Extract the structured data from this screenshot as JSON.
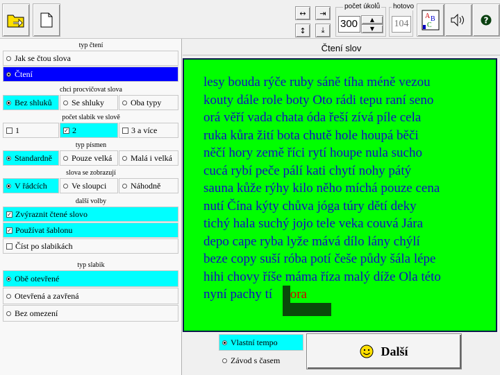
{
  "toolbar": {
    "pocet_ukolu_label": "počet úkolů",
    "pocet_ukolu_value": "300",
    "hotovo_label": "hotovo",
    "hotovo_value": "104"
  },
  "left": {
    "typ_cteni": {
      "title": "typ čtení",
      "opts": [
        "Jak se čtou slova",
        "Čtení"
      ]
    },
    "procvicovat": {
      "title": "chci procvičovat slova",
      "opts": [
        "Bez shluků",
        "Se shluky",
        "Oba typy"
      ]
    },
    "slabiky": {
      "title": "počet slabik ve slově",
      "opts": [
        "1",
        "2",
        "3 a více"
      ]
    },
    "pismen": {
      "title": "typ písmen",
      "opts": [
        "Standardně",
        "Pouze velká",
        "Malá i velká"
      ]
    },
    "zobrazuji": {
      "title": "slova se zobrazují",
      "opts": [
        "V řádcích",
        "Ve sloupci",
        "Náhodně"
      ]
    },
    "dalsi": {
      "title": "další volby",
      "opts": [
        "Zvýraznit čtené slovo",
        "Používat šablonu",
        "Číst po slabikách"
      ]
    },
    "typ_slabik": {
      "title": "typ slabik",
      "opts": [
        "Obě otevřené",
        "Otevřená a zavřená",
        "Bez omezení"
      ]
    }
  },
  "main": {
    "title": "Čtení slov",
    "lines": [
      "lesy bouda rýče ruby sáně tíha méně vezou",
      "kouty dále role boty Oto rádi tepu raní seno",
      "orá věří vada chata óda řeší zívá píle cela",
      "ruka kůra žití bota chutě hole houpá běči",
      "něčí hory země říci rytí houpe nula sucho",
      "cucá rybí peče pálí kati chytí nohy pátý",
      "sauna kůže rýhy kilo něho míchá pouze cena",
      "nutí Čína kýty chůva jóga túry dětí deky",
      "tichý hala suchý jojo tele veka couvá Jára",
      "depo cape ryba lyže mává dílo lány chýlí",
      "beze copy suší róba potí češe půdy šála lépe",
      "hihi chovy říše máma říza malý díže Ola této",
      "nyní pachy tí"
    ],
    "current_word": "hora",
    "mode_options": [
      "Vlastní tempo",
      "Závod s časem"
    ],
    "next_button": "Další"
  }
}
